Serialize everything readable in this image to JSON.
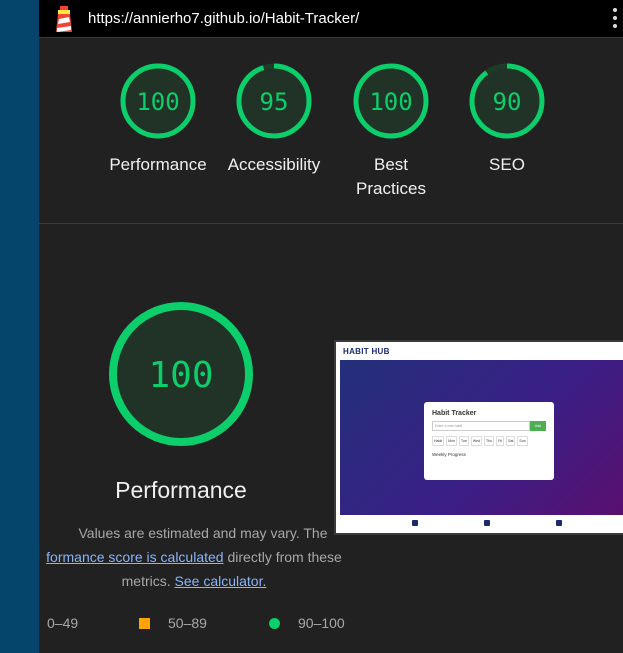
{
  "browser": {
    "url": "https://annierho7.github.io/Habit-Tracker/"
  },
  "scores": [
    {
      "label": "Performance",
      "value": 100
    },
    {
      "label": "Accessibility",
      "value": 95
    },
    {
      "label": "Best Practices",
      "value": 100,
      "lines": [
        "Best",
        "Practices"
      ]
    },
    {
      "label": "SEO",
      "value": 90
    }
  ],
  "main": {
    "score": 100,
    "title": "Performance",
    "desc_line1": "Values are estimated and may vary. The",
    "desc_link1": "formance score is calculated",
    "desc_line2_rest": " directly from these",
    "desc_line3_pre": "metrics. ",
    "desc_link2": "See calculator."
  },
  "legend": {
    "fail": "0–49",
    "average": "50–89",
    "pass": "90–100"
  },
  "colors": {
    "pass": "#0cce6b",
    "average": "#ffa400",
    "gauge_bg": "#213227"
  },
  "screenshot": {
    "brand": "HABIT HUB",
    "card_title": "Habit Tracker",
    "input_placeholder": "Enter a new habit",
    "add_label": "Add",
    "days": [
      "Habit",
      "Mon",
      "Tue",
      "Wed",
      "Thu",
      "Fri",
      "Sat",
      "Sun"
    ],
    "weekly": "Weekly Progress"
  }
}
